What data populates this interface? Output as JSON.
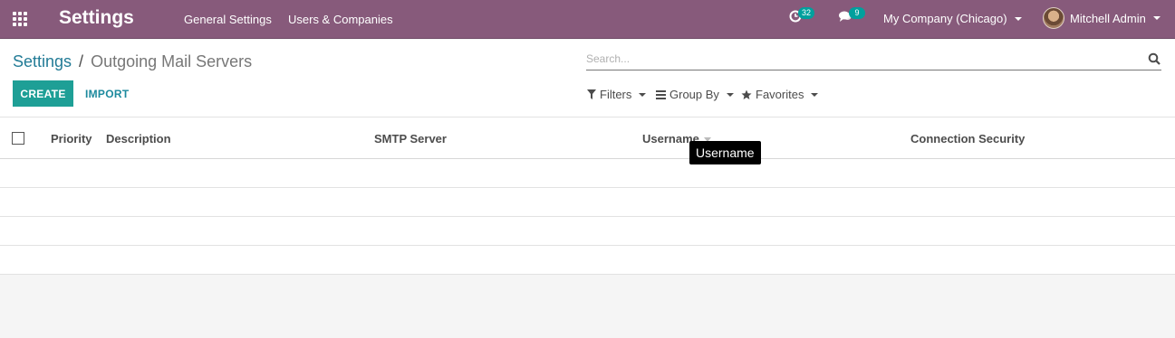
{
  "navbar": {
    "brand": "Settings",
    "menu": [
      "General Settings",
      "Users & Companies"
    ],
    "activity_count": "32",
    "messages_count": "9",
    "company": "My Company (Chicago)",
    "user": "Mitchell Admin",
    "color": "#875a7b"
  },
  "control_panel": {
    "breadcrumb_parent": "Settings",
    "breadcrumb_separator": "/",
    "breadcrumb_current": "Outgoing Mail Servers",
    "create_label": "CREATE",
    "import_label": "IMPORT",
    "search_placeholder": "Search...",
    "filters_label": "Filters",
    "groupby_label": "Group By",
    "favorites_label": "Favorites",
    "accent_color": "#1e9f96"
  },
  "list": {
    "columns": [
      "Priority",
      "Description",
      "SMTP Server",
      "Username",
      "Connection Security"
    ],
    "rows": []
  },
  "tooltip": "Username"
}
